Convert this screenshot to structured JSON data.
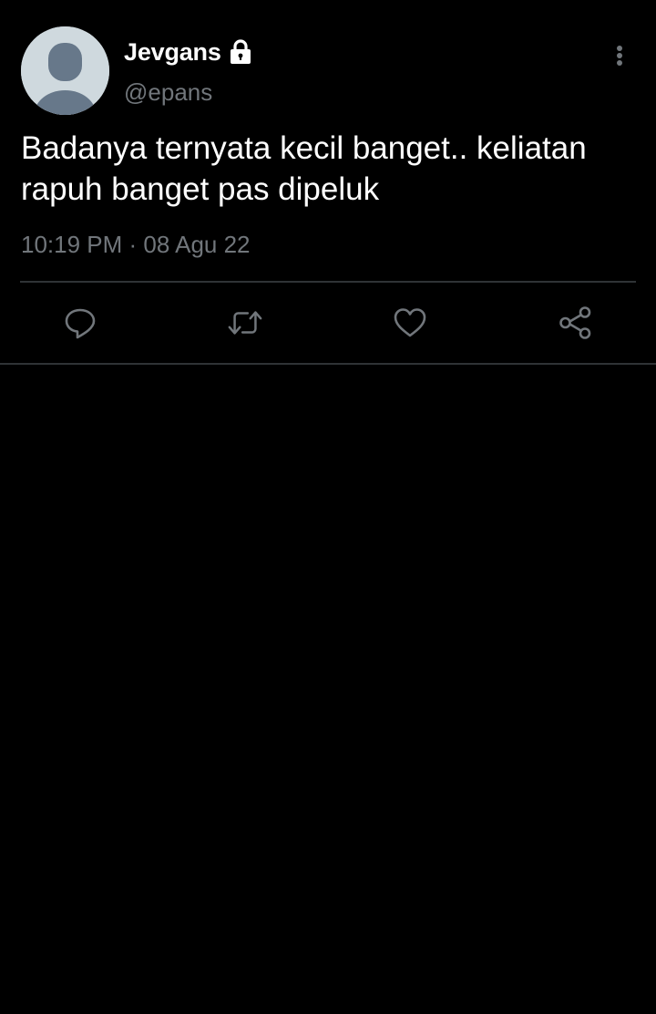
{
  "tweet": {
    "display_name": "Jevgans",
    "handle": "@epans",
    "text": "Badanya ternyata kecil banget.. keliatan rapuh banget pas dipeluk",
    "timestamp": "10:19 PM · 08 Agu 22",
    "protected": true
  },
  "icons": {
    "avatar": "default-avatar-icon",
    "lock": "lock-icon",
    "more": "more-vertical-icon",
    "reply": "reply-icon",
    "retweet": "retweet-icon",
    "like": "heart-icon",
    "share": "share-icon"
  },
  "colors": {
    "background": "#000000",
    "primary_text": "#ffffff",
    "secondary_text": "#71767b",
    "divider": "#2f3336",
    "avatar_bg": "#cfd9de",
    "avatar_figure": "#67788a"
  }
}
